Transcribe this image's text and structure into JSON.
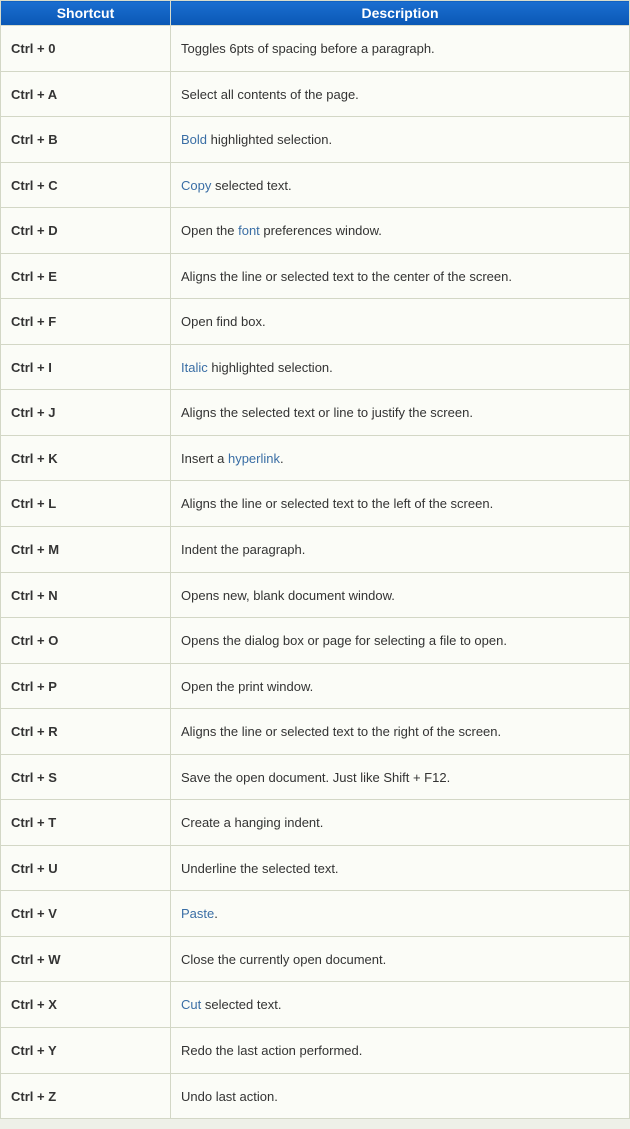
{
  "headers": {
    "shortcut": "Shortcut",
    "description": "Description"
  },
  "rows": [
    {
      "shortcut": "Ctrl + 0",
      "desc": [
        {
          "t": "text",
          "v": "Toggles 6pts of spacing before a paragraph."
        }
      ]
    },
    {
      "shortcut": "Ctrl + A",
      "desc": [
        {
          "t": "text",
          "v": "Select all contents of the page."
        }
      ]
    },
    {
      "shortcut": "Ctrl + B",
      "desc": [
        {
          "t": "link",
          "v": "Bold"
        },
        {
          "t": "text",
          "v": " highlighted selection."
        }
      ]
    },
    {
      "shortcut": "Ctrl + C",
      "desc": [
        {
          "t": "link",
          "v": "Copy"
        },
        {
          "t": "text",
          "v": " selected text."
        }
      ]
    },
    {
      "shortcut": "Ctrl + D",
      "desc": [
        {
          "t": "text",
          "v": "Open the "
        },
        {
          "t": "link",
          "v": "font"
        },
        {
          "t": "text",
          "v": " preferences window."
        }
      ]
    },
    {
      "shortcut": "Ctrl + E",
      "desc": [
        {
          "t": "text",
          "v": "Aligns the line or selected text to the center of the screen."
        }
      ]
    },
    {
      "shortcut": "Ctrl + F",
      "desc": [
        {
          "t": "text",
          "v": "Open find box."
        }
      ]
    },
    {
      "shortcut": "Ctrl + I",
      "desc": [
        {
          "t": "link",
          "v": "Italic"
        },
        {
          "t": "text",
          "v": " highlighted selection."
        }
      ]
    },
    {
      "shortcut": "Ctrl + J",
      "desc": [
        {
          "t": "text",
          "v": "Aligns the selected text or line to justify the screen."
        }
      ]
    },
    {
      "shortcut": "Ctrl + K",
      "desc": [
        {
          "t": "text",
          "v": "Insert a "
        },
        {
          "t": "link",
          "v": "hyperlink"
        },
        {
          "t": "text",
          "v": "."
        }
      ]
    },
    {
      "shortcut": "Ctrl + L",
      "desc": [
        {
          "t": "text",
          "v": "Aligns the line or selected text to the left of the screen."
        }
      ]
    },
    {
      "shortcut": "Ctrl + M",
      "desc": [
        {
          "t": "text",
          "v": "Indent the paragraph."
        }
      ]
    },
    {
      "shortcut": "Ctrl + N",
      "desc": [
        {
          "t": "text",
          "v": "Opens new, blank document window."
        }
      ]
    },
    {
      "shortcut": "Ctrl + O",
      "desc": [
        {
          "t": "text",
          "v": "Opens the dialog box or page for selecting a file to open."
        }
      ]
    },
    {
      "shortcut": "Ctrl + P",
      "desc": [
        {
          "t": "text",
          "v": "Open the print window."
        }
      ]
    },
    {
      "shortcut": "Ctrl + R",
      "desc": [
        {
          "t": "text",
          "v": "Aligns the line or selected text to the right of the screen."
        }
      ]
    },
    {
      "shortcut": "Ctrl + S",
      "desc": [
        {
          "t": "text",
          "v": "Save the open document. Just like Shift + F12."
        }
      ]
    },
    {
      "shortcut": "Ctrl + T",
      "desc": [
        {
          "t": "text",
          "v": "Create a hanging indent."
        }
      ]
    },
    {
      "shortcut": "Ctrl + U",
      "desc": [
        {
          "t": "text",
          "v": "Underline the selected text."
        }
      ]
    },
    {
      "shortcut": "Ctrl + V",
      "desc": [
        {
          "t": "link",
          "v": "Paste"
        },
        {
          "t": "text",
          "v": "."
        }
      ]
    },
    {
      "shortcut": "Ctrl + W",
      "desc": [
        {
          "t": "text",
          "v": "Close the currently open document."
        }
      ]
    },
    {
      "shortcut": "Ctrl + X",
      "desc": [
        {
          "t": "link",
          "v": "Cut"
        },
        {
          "t": "text",
          "v": " selected text."
        }
      ]
    },
    {
      "shortcut": "Ctrl + Y",
      "desc": [
        {
          "t": "text",
          "v": "Redo the last action performed."
        }
      ]
    },
    {
      "shortcut": "Ctrl + Z",
      "desc": [
        {
          "t": "text",
          "v": "Undo last action."
        }
      ]
    }
  ]
}
